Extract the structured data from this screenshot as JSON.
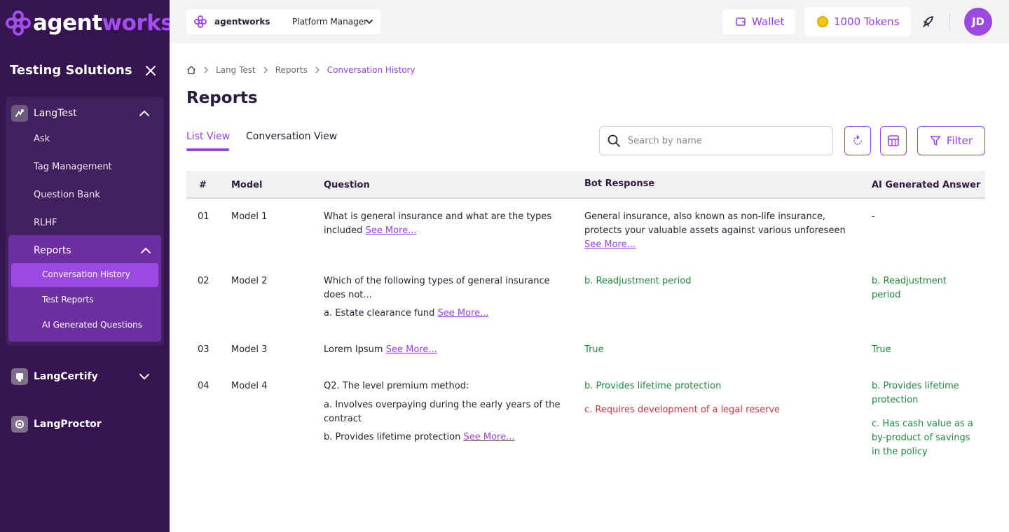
{
  "brand": {
    "name_a": "agent",
    "name_b": "works"
  },
  "sidebar": {
    "section_title": "Testing Solutions",
    "langtest": {
      "label": "LangTest",
      "items": [
        "Ask",
        "Tag Management",
        "Question Bank",
        "RLHF"
      ],
      "reports": {
        "label": "Reports",
        "items": [
          "Conversation History",
          "Test Reports",
          "AI Generated Questions"
        ],
        "active": "Conversation History"
      }
    },
    "langcertify": {
      "label": "LangCertify"
    },
    "langproctor": {
      "label": "LangProctor"
    }
  },
  "topbar": {
    "workspace": "agentworks",
    "role": "Platform Manager",
    "wallet_label": "Wallet",
    "tokens_label": "1000 Tokens",
    "avatar_initials": "JD"
  },
  "breadcrumb": [
    "Lang Test",
    "Reports",
    "Conversation History"
  ],
  "page_title": "Reports",
  "tabs": {
    "list": "List View",
    "conversation": "Conversation View"
  },
  "search": {
    "placeholder": "Search by name"
  },
  "filter_label": "Filter",
  "table": {
    "headers": {
      "num": "#",
      "model": "Model",
      "question": "Question",
      "bot": "Bot Response",
      "ai": "AI Generated Answer"
    },
    "see_more": "See More...",
    "rows": [
      {
        "num": "01",
        "model": "Model 1",
        "question": [
          "What is general insurance and what are the types included"
        ],
        "bot": [
          "General insurance, also known as non-life insurance, protects your valuable assets against various unforeseen"
        ],
        "ai": [
          "-"
        ]
      },
      {
        "num": "02",
        "model": "Model 2",
        "question": [
          "Which of the following types of general insurance does not...",
          "a. Estate clearance fund"
        ],
        "bot": [
          "b. Readjustment period"
        ],
        "ai": [
          "b. Readjustment period"
        ]
      },
      {
        "num": "03",
        "model": "Model 3",
        "question": [
          "Lorem Ipsum"
        ],
        "bot": [
          "True"
        ],
        "ai": [
          "True"
        ]
      },
      {
        "num": "04",
        "model": "Model 4",
        "question": [
          "Q2. The level premium method:",
          "a. Involves overpaying during the early years of the contract",
          "b. Provides lifetime protection"
        ],
        "bot": [
          "b. Provides lifetime protection",
          "c. Requires development of a legal reserve"
        ],
        "ai": [
          "b. Provides lifetime protection",
          "c. Has cash value as a by-product of savings in the policy"
        ]
      }
    ]
  },
  "colors": {
    "sidebar_bg": "#34154f",
    "accent": "#9a3ff0",
    "correct": "#1f8a3a",
    "incorrect": "#d6343a"
  }
}
